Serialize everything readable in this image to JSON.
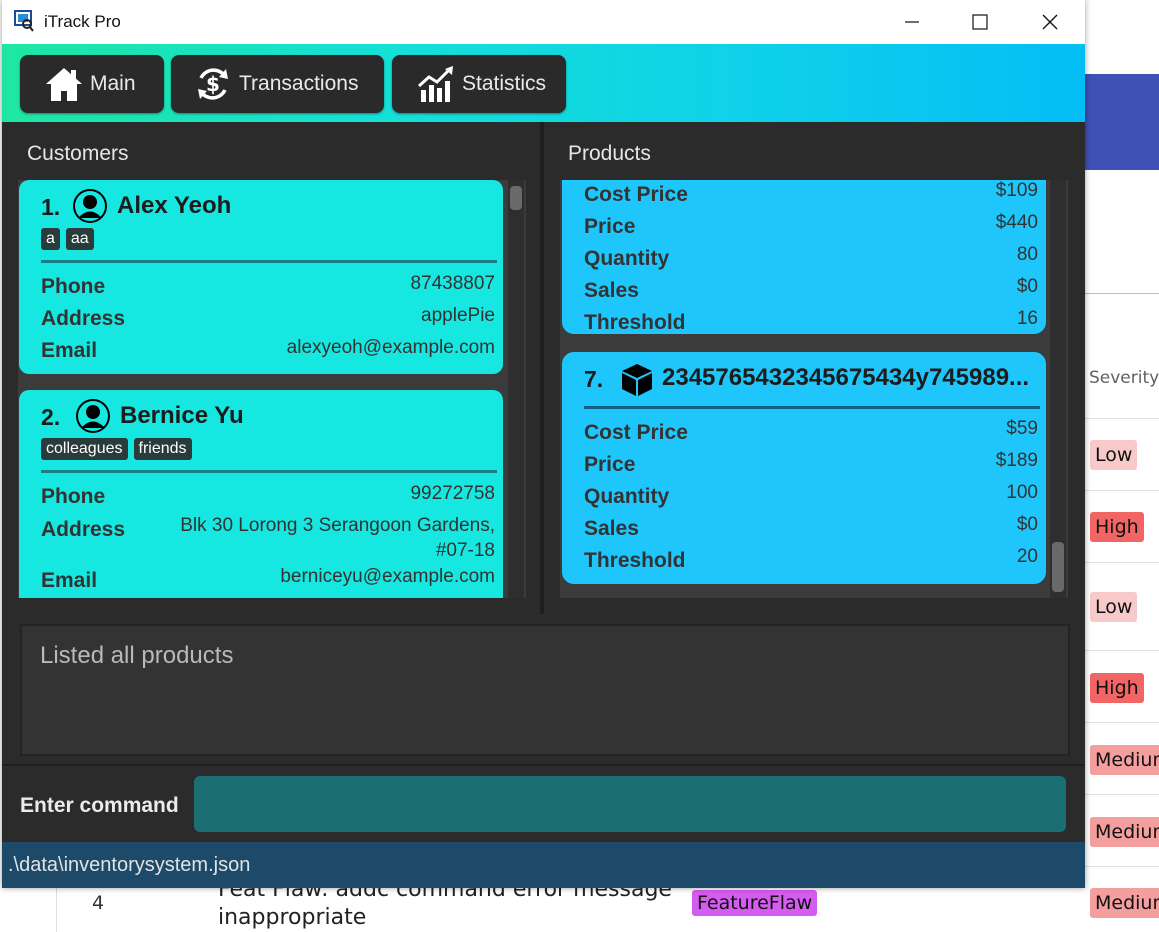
{
  "window": {
    "title": "iTrack Pro"
  },
  "nav": {
    "main": "Main",
    "transactions": "Transactions",
    "statistics": "Statistics"
  },
  "customers": {
    "title": "Customers",
    "cards": [
      {
        "index": "1.",
        "name": "Alex Yeoh",
        "tags": [
          "a",
          "aa"
        ],
        "phone_label": "Phone",
        "phone": "87438807",
        "address_label": "Address",
        "address": "applePie",
        "email_label": "Email",
        "email": "alexyeoh@example.com"
      },
      {
        "index": "2.",
        "name": "Bernice Yu",
        "tags": [
          "colleagues",
          "friends"
        ],
        "phone_label": "Phone",
        "phone": "99272758",
        "address_label": "Address",
        "address_line1": "Blk 30 Lorong 3 Serangoon Gardens,",
        "address_line2": "#07-18",
        "email_label": "Email",
        "email": "berniceyu@example.com"
      }
    ]
  },
  "products": {
    "title": "Products",
    "cards": [
      {
        "cost_label": "Cost Price",
        "cost": "$109",
        "price_label": "Price",
        "price": "$440",
        "qty_label": "Quantity",
        "qty": "80",
        "sales_label": "Sales",
        "sales": "$0",
        "threshold_label": "Threshold",
        "threshold": "16"
      },
      {
        "index": "7.",
        "name": "2345765432345675434y745989...",
        "cost_label": "Cost Price",
        "cost": "$59",
        "price_label": "Price",
        "price": "$189",
        "qty_label": "Quantity",
        "qty": "100",
        "sales_label": "Sales",
        "sales": "$0",
        "threshold_label": "Threshold",
        "threshold": "20"
      }
    ]
  },
  "result": {
    "text": "Listed all products"
  },
  "command": {
    "label": "Enter command",
    "value": ""
  },
  "status": {
    "path": ".\\data\\inventorysystem.json"
  },
  "background": {
    "severity_header": "Severity",
    "severities": [
      "Low",
      "High",
      "Low",
      "High",
      "Medium",
      "Medium",
      "Medium"
    ],
    "row_number": "4",
    "row_title_line1": "Feat Flaw: addc command error message",
    "row_title_line2": "inappropriate",
    "row_tag": "FeatureFlaw"
  },
  "colors": {
    "customer_card": "#16e7e0",
    "product_card": "#1ec6fb",
    "status_bar": "#1c4a68",
    "command_input": "#1b6f72",
    "toolbar_gradient": [
      "#1ee6a2",
      "#04bdf5"
    ],
    "severity_low": "#f8c9c9",
    "severity_high": "#f16565",
    "severity_medium": "#f49e9e",
    "tag_featureflaw": "#d55cf0"
  },
  "icons": {
    "app": "itrack-app-icon",
    "main": "house-icon",
    "transactions": "dollar-cycle-icon",
    "statistics": "chart-up-icon",
    "customer": "person-icon",
    "product": "cube-icon"
  }
}
